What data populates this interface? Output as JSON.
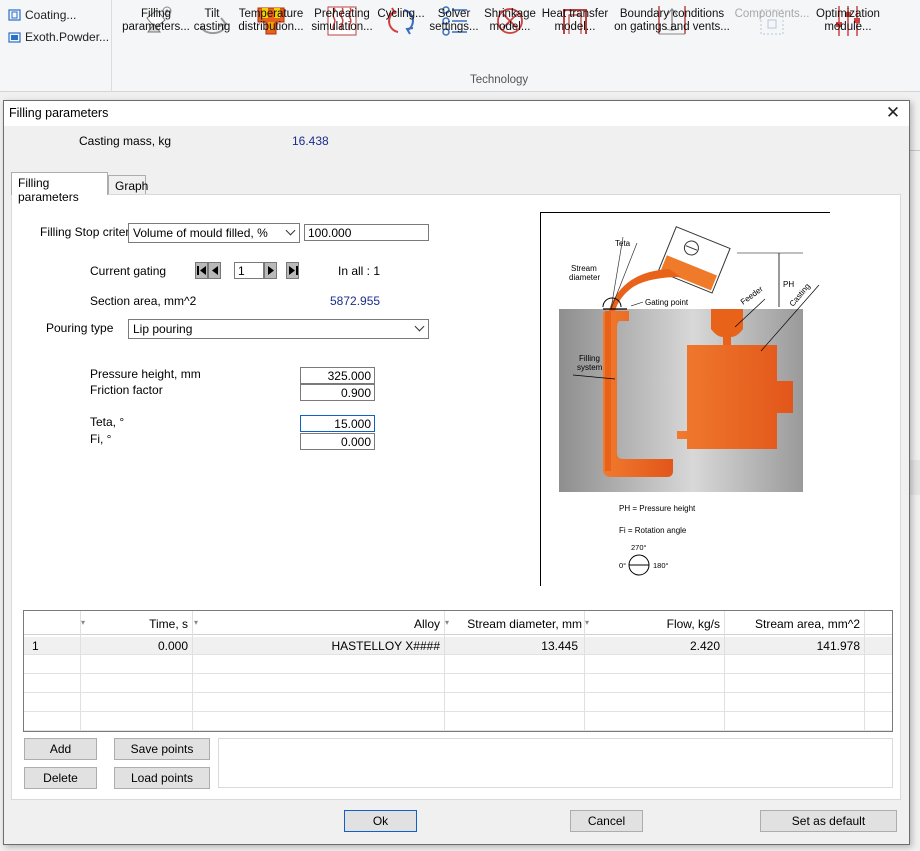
{
  "ribbon": {
    "left_items": [
      {
        "icon": "coating-icon",
        "label": "Coating..."
      },
      {
        "icon": "exothermic-powder-icon",
        "label": "Exoth.Powder..."
      }
    ],
    "buttons": [
      {
        "icon": "filling-parameters-icon",
        "line1": "Filling",
        "line2": "parameters...",
        "enabled": true
      },
      {
        "icon": "tilt-casting-icon",
        "line1": "Tilt",
        "line2": "casting",
        "enabled": true
      },
      {
        "icon": "temperature-distribution-icon",
        "line1": "Temperature",
        "line2": "distribution...",
        "enabled": true
      },
      {
        "icon": "preheating-simulation-icon",
        "line1": "Preheating",
        "line2": "simulation...",
        "enabled": true
      },
      {
        "icon": "cycling-icon",
        "line1": "Cycling...",
        "line2": "",
        "enabled": true
      },
      {
        "icon": "solver-settings-icon",
        "line1": "Solver",
        "line2": "settings...",
        "enabled": true
      },
      {
        "icon": "shrinkage-model-icon",
        "line1": "Shrinkage",
        "line2": "model...",
        "enabled": true
      },
      {
        "icon": "heat-transfer-model-icon",
        "line1": "Heat transfer",
        "line2": "model...",
        "enabled": true
      },
      {
        "icon": "boundary-conditions-icon",
        "line1": "Boundary conditions",
        "line2": "on gatings and vents...",
        "enabled": true
      },
      {
        "icon": "components-icon",
        "line1": "Components...",
        "line2": "",
        "enabled": false
      },
      {
        "icon": "optimization-module-icon",
        "line1": "Optimization",
        "line2": "module...",
        "enabled": true
      }
    ],
    "group_label": "Technology"
  },
  "dialog": {
    "title": "Filling parameters",
    "casting_mass_label": "Casting mass, kg",
    "casting_mass_value": "16.438",
    "tabs": [
      {
        "label": "Filling parameters",
        "active": true
      },
      {
        "label": "Graph",
        "active": false
      }
    ],
    "form": {
      "stop_criteria_label": "Filling Stop criteria",
      "stop_criteria_selected": "Volume of mould filled, %",
      "stop_criteria_value": "100.000",
      "current_gating_label": "Current gating",
      "current_gating_value": "1",
      "in_all_label": "In all : 1",
      "section_area_label": "Section area, mm^2",
      "section_area_value": "5872.955",
      "pouring_type_label": "Pouring type",
      "pouring_type_selected": "Lip pouring",
      "pressure_height_label": "Pressure height, mm",
      "pressure_height_value": "325.000",
      "friction_factor_label": "Friction factor",
      "friction_factor_value": "0.900",
      "teta_label": "Teta, °",
      "teta_value": "15.000",
      "fi_label": "Fi, °",
      "fi_value": "0.000"
    },
    "diagram": {
      "teta": "Teta",
      "stream_diameter_1": "Stream",
      "stream_diameter_2": "diameter",
      "gating_point": "Gating point",
      "ph": "PH",
      "feeder": "Feeder",
      "casting": "Casting",
      "filling_system_1": "Filling",
      "filling_system_2": "system",
      "ph_legend": "PH = Pressure height",
      "fi_legend": "Fi = Rotation angle",
      "angle_0": "0°",
      "angle_180": "180°",
      "angle_270": "270°",
      "colors": {
        "metal": "#e8621a",
        "mould": "#a9a9a9",
        "ladle": "#ee7a2a"
      }
    },
    "table": {
      "columns": [
        "Time, s",
        "Alloy",
        "Stream diameter, mm",
        "Flow, kg/s",
        "Stream area, mm^2"
      ],
      "rows": [
        {
          "index": "1",
          "time": "0.000",
          "alloy": "HASTELLOY X####",
          "stream_diameter": "13.445",
          "flow": "2.420",
          "stream_area": "141.978"
        }
      ]
    },
    "buttons": {
      "add": "Add",
      "save_points": "Save points",
      "delete": "Delete",
      "load_points": "Load points",
      "ok": "Ok",
      "cancel": "Cancel",
      "set_default": "Set as default"
    }
  }
}
